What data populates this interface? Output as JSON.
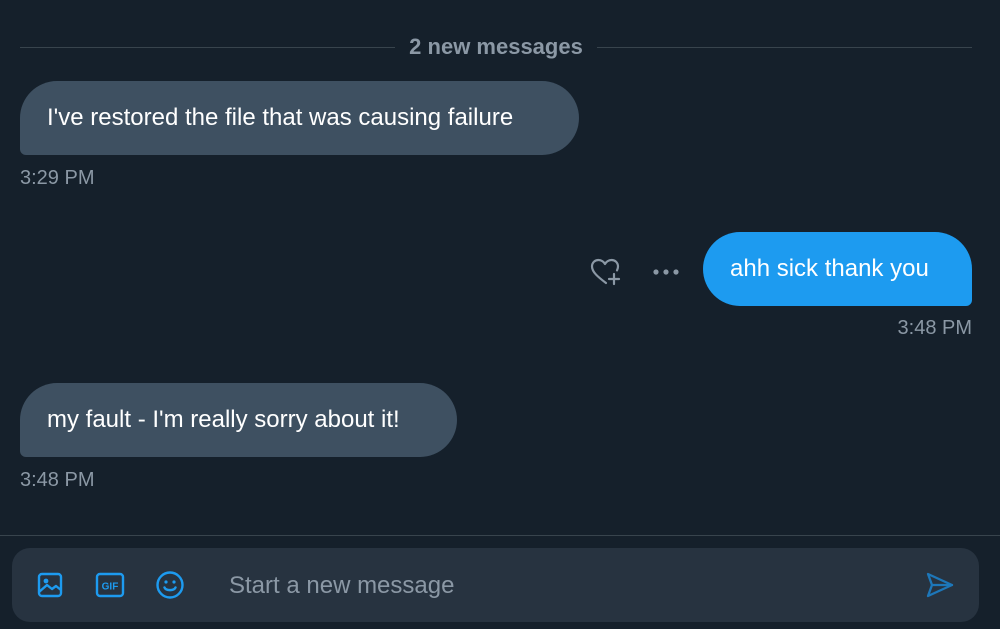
{
  "divider": {
    "label": "2 new messages"
  },
  "messages": [
    {
      "direction": "received",
      "text": "I've restored the file that was causing failure",
      "time": "3:29 PM"
    },
    {
      "direction": "sent",
      "text": "ahh sick thank you",
      "time": "3:48 PM"
    },
    {
      "direction": "received",
      "text": "my fault - I'm really sorry about it!",
      "time": "3:48 PM"
    }
  ],
  "message_actions": {
    "icons": [
      "heart-plus-icon",
      "more-icon"
    ]
  },
  "composer": {
    "placeholder": "Start a new message",
    "value": "",
    "icons": [
      "image-icon",
      "gif-icon",
      "emoji-icon",
      "send-icon"
    ],
    "gif_text": "GIF"
  },
  "colors": {
    "background": "#15202b",
    "received_bubble": "#3e5061",
    "sent_bubble": "#1d9bf0",
    "accent": "#1d9bf0",
    "muted_text": "#8b98a5",
    "composer_bg": "#273340"
  }
}
